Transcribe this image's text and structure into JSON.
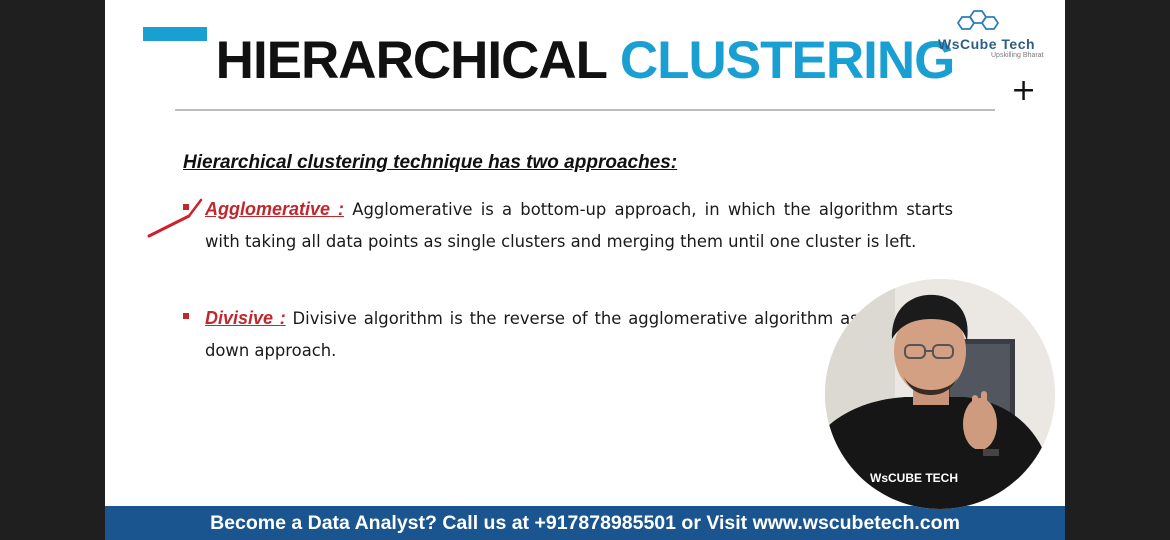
{
  "slide": {
    "title_part1": "HIERARCHICAL",
    "title_part2": "CLUSTERING",
    "heading": "Hierarchical clustering technique has two approaches:",
    "bullets": [
      {
        "term": "Agglomerative :",
        "text": "Agglomerative is a bottom-up approach, in which the algorithm starts with taking all data points as single clusters and merging them until one cluster is left."
      },
      {
        "term": "Divisive :",
        "text": "Divisive algorithm is the reverse of the agglomerative algorithm as it is a top-down approach."
      }
    ]
  },
  "logo": {
    "name": "WsCube Tech",
    "tagline": "Upskilling Bharat"
  },
  "banner": {
    "text": "Become a Data Analyst? Call us at +917878985501 or Visit www.wscubetech.com"
  },
  "presenter": {
    "shirt_text": "WsCUBE TECH"
  },
  "colors": {
    "accent": "#1a9fd3",
    "red": "#c0282d",
    "banner": "#1a5590"
  },
  "icons": {
    "plus": "plus-icon",
    "annotation": "checkmark-annotation-icon"
  }
}
